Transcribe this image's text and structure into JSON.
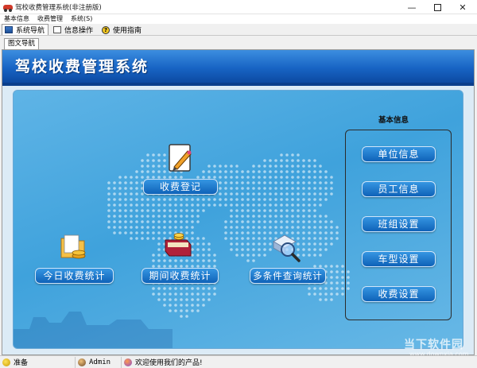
{
  "window": {
    "title": "驾校收费管理系统(非注册版)"
  },
  "menu": {
    "items": [
      "基本信息",
      "收费管理",
      "系统(S)"
    ]
  },
  "toolbar": {
    "tabs": [
      "系统导航",
      "信息操作",
      "使用指南"
    ]
  },
  "subtab": {
    "label": "图文导航"
  },
  "banner": {
    "title": "驾校收费管理系统"
  },
  "functions": {
    "register": "收费登记",
    "today": "今日收费统计",
    "period": "期间收费统计",
    "query": "多条件查询统计"
  },
  "basic_info": {
    "title": "基本信息",
    "buttons": [
      "单位信息",
      "员工信息",
      "班组设置",
      "车型设置",
      "收费设置"
    ]
  },
  "status": {
    "ready": "准备",
    "user": "Admin",
    "message": "欢迎使用我们的产品!"
  },
  "watermark": {
    "text": "当下软件园",
    "sub": "www.downxia.com"
  },
  "colors": {
    "banner": "#1864c4",
    "button": "#0f62b8",
    "canvas": "#3fa2dc"
  }
}
